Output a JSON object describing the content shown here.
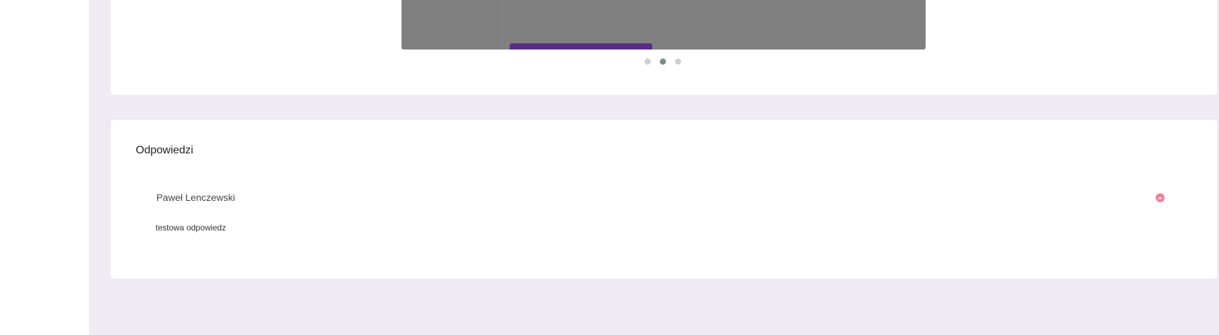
{
  "slider": {
    "dot_count": 3,
    "active_index": 1
  },
  "answers": {
    "title": "Odpowiedzi",
    "items": [
      {
        "author": "Paweł Lenczewski",
        "text": "testowa odpowiedz",
        "action_icon": "chevron-up-icon"
      }
    ]
  },
  "colors": {
    "page_background": "#f0ebf2",
    "card_background": "#ffffff",
    "slide_background": "#808080",
    "slide_accent": "#5b2d88",
    "dot_active": "#808a8a",
    "dot_inactive": "#cfcfcf",
    "collapse_button": "#f48097"
  }
}
